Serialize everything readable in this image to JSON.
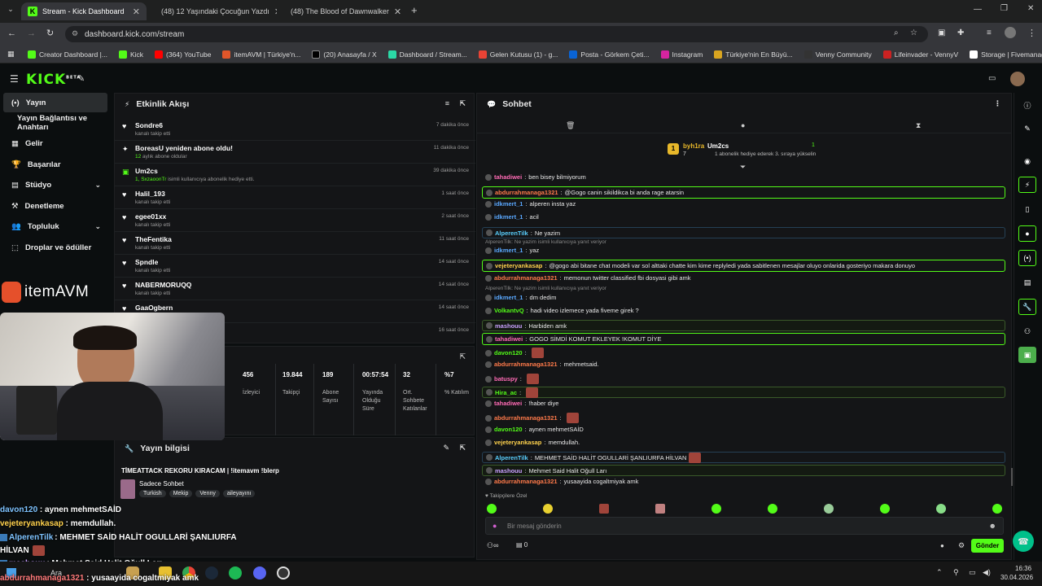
{
  "browser": {
    "tabs": [
      {
        "title": "Stream - Kick Dashboard",
        "active": true
      },
      {
        "title": "(48) 12 Yaşındaki Çocuğun Yazdı"
      },
      {
        "title": "(48) The Blood of Dawnwalker"
      }
    ],
    "url": "dashboard.kick.com/stream",
    "bookmarks": [
      "Creator Dashboard |...",
      "Kick",
      "(364) YouTube",
      "itemAVM | Türkiye'n...",
      "(20) Anasayfa / X",
      "Dashboard / Stream...",
      "Gelen Kutusu (1) - g...",
      "Posta - Görkem Çeti...",
      "Instagram",
      "Türkiye'nin En Büyü...",
      "Venny Community",
      "Lifeinvader - VennyV",
      "Storage | Fivemanage"
    ]
  },
  "kick": {
    "logo": "KICK",
    "beta": "BETA"
  },
  "sidebar": {
    "items": [
      {
        "label": "Yayın",
        "icon": "(•)"
      },
      {
        "label": "Yayın Bağlantısı ve Anahtarı",
        "icon": ""
      },
      {
        "label": "Gelir",
        "icon": "▦"
      },
      {
        "label": "Başarılar",
        "icon": "🏆"
      },
      {
        "label": "Stüdyo",
        "icon": "▤"
      },
      {
        "label": "Denetleme",
        "icon": "⚒"
      },
      {
        "label": "Topluluk",
        "icon": "👥"
      },
      {
        "label": "Droplar ve ödüller",
        "icon": "⬚"
      }
    ]
  },
  "activity": {
    "title": "Etkinlik Akışı",
    "events": [
      {
        "name": "Sondre6",
        "sub": "kanalı takip etti",
        "time": "7 dakika önce",
        "icon": "♥"
      },
      {
        "name": "BoreasU yeniden abone oldu!",
        "sub": "aylık abone oldular",
        "subnum": "12",
        "time": "11 dakika önce",
        "icon": "✦"
      },
      {
        "name": "Um2cs",
        "sub": "isimli kullanıcıya abonelik hediye etti.",
        "subnum": "1, SxzaoonTr",
        "time": "39 dakika önce",
        "icon": "▣"
      },
      {
        "name": "Halil_193",
        "sub": "kanalı takip etti",
        "time": "1 saat önce",
        "icon": "♥"
      },
      {
        "name": "egee01xx",
        "sub": "kanalı takip etti",
        "time": "2 saat önce",
        "icon": "♥"
      },
      {
        "name": "TheFentika",
        "sub": "kanalı takip etti",
        "time": "11 saat önce",
        "icon": "♥"
      },
      {
        "name": "Spndle",
        "sub": "kanalı takip etti",
        "time": "14 saat önce",
        "icon": "♥"
      },
      {
        "name": "NABERMORUQQ",
        "sub": "kanalı takip etti",
        "time": "14 saat önce",
        "icon": "♥"
      },
      {
        "name": "GaaOgbern",
        "sub": "",
        "time": "14 saat önce",
        "icon": "♥"
      },
      {
        "name": "",
        "sub": "",
        "time": "16 saat önce",
        "icon": ""
      }
    ]
  },
  "stats": [
    {
      "value": "456",
      "label": "İzleyici"
    },
    {
      "value": "19.844",
      "label": "Takipçi"
    },
    {
      "value": "189",
      "label": "Abone Sayısı"
    },
    {
      "value": "00:57:54",
      "label": "Yayında Olduğu Süre"
    },
    {
      "value": "32",
      "label": "Ort. Sohbete Katılanlar"
    },
    {
      "value": "%7",
      "label": "% Katılım"
    }
  ],
  "streaminfo": {
    "title": "Yayın bilgisi",
    "stream_title": "TİMEATTACK REKORU KIRACAM | !itemavm !blerp",
    "category": "Sadece Sohbet",
    "tags": [
      "Turkish",
      "Mekip",
      "Venny",
      "aileyayını"
    ]
  },
  "overlay": {
    "brand": "itemAVM",
    "lines": [
      {
        "user": "davon120",
        "text": " : aynen mehmetSAİD",
        "color": "#7ec3ff"
      },
      {
        "user": "vejeteryankasap",
        "text": " : memdullah.",
        "color": "#ffd24d"
      },
      {
        "user": "AlperenTilk",
        "text": " : MEHMET SAİD HALİT OGULLARİ ŞANLIURFA",
        "color": "#7ec3ff"
      },
      {
        "user": "",
        "text": "HİLVAN",
        "color": "#fff"
      },
      {
        "user": "mashouu",
        "text": " : Mehmet Said Halit Oğull Ları",
        "color": "#c9a0ff"
      },
      {
        "user": "abdurrahmanaga1321",
        "text": " : yusaayida cogaltmiyak amk",
        "color": "#ff7a7a"
      }
    ]
  },
  "chat": {
    "title": "Sohbet",
    "pinned": {
      "user1": "byh1ra",
      "count1": "7",
      "user2": "Um2cs",
      "count2": "1",
      "note": "1 abonelik hediye ederek 3. sıraya yükselin"
    },
    "messages": [
      {
        "user": "tahadiwei",
        "text": "ben bisey bilmiyorum",
        "color": "#ff6bb5",
        "style": ""
      },
      {
        "user": "abdurrahmanaga1321",
        "text": "@Gogo canin sikildikca bi anda rage atarsin",
        "color": "#ff7a4a",
        "style": "hl",
        "mention": true
      },
      {
        "user": "idkmert_1",
        "text": "alperen insta yaz",
        "color": "#5aa8ff",
        "style": ""
      },
      {
        "user": "idkmert_1",
        "text": "acil",
        "color": "#5aa8ff",
        "style": ""
      },
      {
        "user": "AlperenTilk",
        "text": "Ne yazim",
        "color": "#5ad1ff",
        "style": "hlb"
      },
      {
        "reply": "AlperenTilk: Ne yazim isimli kullanıcıya yanıt veriyor"
      },
      {
        "user": "idkmert_1",
        "text": "yaz",
        "color": "#5aa8ff",
        "style": ""
      },
      {
        "user": "vejeteryankasap",
        "text": "@gogo abi bitane chat modeli var sol alttaki chatte kim kime replyledi yada sabitlenen mesajlar oluyo onlarida gosteriyo makara donuyo",
        "color": "#ffd24d",
        "style": "hl"
      },
      {
        "user": "abdurrahmanaga1321",
        "text": "memonun twitter classified fbi dosyasi gibi amk",
        "color": "#ff7a4a",
        "style": ""
      },
      {
        "reply": "AlperenTilk: Ne yazim isimli kullanıcıya yanıt veriyor"
      },
      {
        "user": "idkmert_1",
        "text": "dm dedim",
        "color": "#5aa8ff",
        "style": ""
      },
      {
        "user": "VolkantvQ",
        "text": "hadi video izlemece yada fiveme girek ?",
        "color": "#53fc18",
        "style": ""
      },
      {
        "user": "mashouu",
        "text": "Harbiden amk",
        "color": "#c9a0ff",
        "style": "hlg"
      },
      {
        "user": "tahadiwei",
        "text": "GOGO SİMDİ KOMUT EKLEYEK !KOMUT DİYE",
        "color": "#ff6bb5",
        "style": "hl"
      },
      {
        "user": "davon120",
        "text": "",
        "color": "#53fc18",
        "style": "",
        "emote": true
      },
      {
        "user": "abdurrahmanaga1321",
        "text": "mehmetsaid.",
        "color": "#ff7a4a",
        "style": ""
      },
      {
        "user": "batuspy",
        "text": "",
        "color": "#ff6bb5",
        "style": "",
        "emote": true
      },
      {
        "user": "Hira_ac",
        "text": "",
        "color": "#53fc18",
        "style": "hlg",
        "emote": true
      },
      {
        "user": "tahadiwei",
        "text": "!haber diye",
        "color": "#ff6bb5",
        "style": ""
      },
      {
        "user": "abdurrahmanaga1321",
        "text": "",
        "color": "#ff7a4a",
        "style": "",
        "emote": true
      },
      {
        "user": "davon120",
        "text": "aynen mehmetSAİD",
        "color": "#53fc18",
        "style": ""
      },
      {
        "user": "vejeteryankasap",
        "text": "memdullah.",
        "color": "#ffd24d",
        "style": ""
      },
      {
        "user": "AlperenTilk",
        "text": "MEHMET SAİD HALİT OGULLARİ ŞANLIURFA HİLVAN",
        "color": "#5ad1ff",
        "style": "hlb",
        "emote": true
      },
      {
        "user": "mashouu",
        "text": "Mehmet Said Halit Oğull Ları",
        "color": "#c9a0ff",
        "style": "hlg"
      },
      {
        "user": "abdurrahmanaga1321",
        "text": "yusaayida cogaltmiyak amk",
        "color": "#ff7a4a",
        "style": ""
      }
    ],
    "followers_only": "Takipçilere Özel",
    "input_placeholder": "Bir mesaj gönderin",
    "send_label": "Gönder",
    "points": "0"
  },
  "taskbar": {
    "search": "Ara",
    "time": "16:36",
    "date": "30.04.2026"
  }
}
